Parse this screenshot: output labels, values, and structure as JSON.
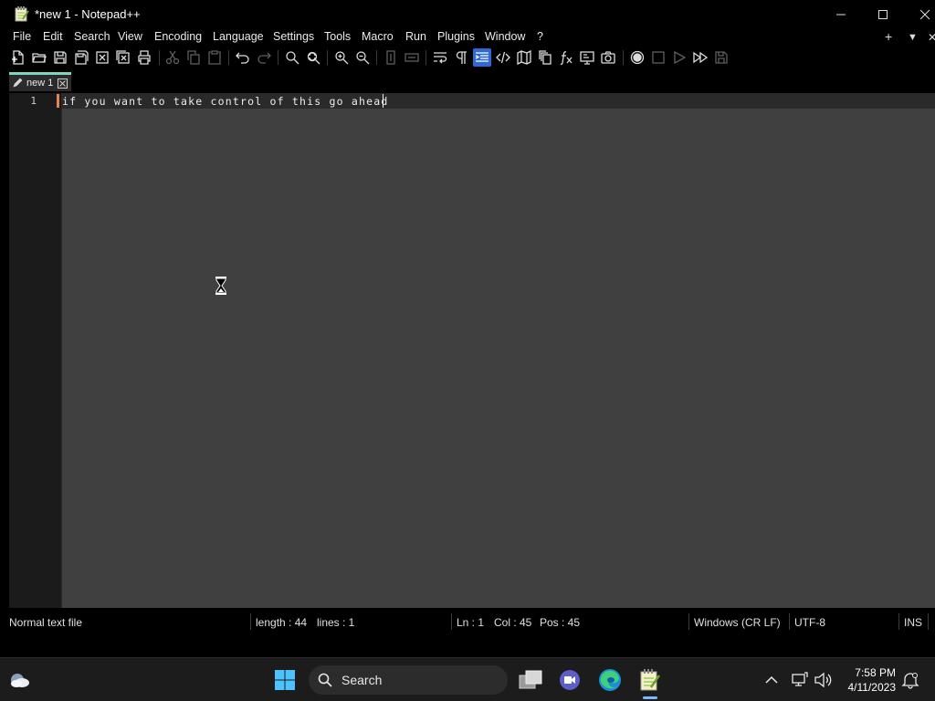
{
  "window": {
    "title": "*new 1 - Notepad++",
    "controls": [
      "minimize",
      "maximize",
      "close"
    ]
  },
  "menu": {
    "items": [
      "File",
      "Edit",
      "Search",
      "View",
      "Encoding",
      "Language",
      "Settings",
      "Tools",
      "Macro",
      "Run",
      "Plugins",
      "Window",
      "?"
    ],
    "right_actions": [
      "+",
      "▼",
      "✕"
    ]
  },
  "toolbar": {
    "icons": [
      "new-file-icon",
      "open-file-icon",
      "save-icon",
      "save-all-icon",
      "close-icon",
      "close-all-icon",
      "print-icon",
      "cut-icon",
      "copy-icon",
      "paste-icon",
      "undo-icon",
      "redo-icon",
      "find-icon",
      "replace-icon",
      "zoom-in-icon",
      "zoom-out-icon",
      "sync-vertical-icon",
      "sync-horizontal-icon",
      "word-wrap-icon",
      "show-all-characters-icon",
      "indent-guide-icon",
      "xml-tag-icon",
      "document-map-icon",
      "document-list-icon",
      "function-list-icon",
      "folder-workspace-icon",
      "monitoring-icon",
      "record-macro-icon",
      "stop-recording-icon",
      "playback-macro-icon",
      "run-macro-multiple-icon",
      "save-macro-icon"
    ]
  },
  "tab": {
    "label": "new 1"
  },
  "editor": {
    "line_number": "1",
    "text": "if you want to take control of this go ahead"
  },
  "status": {
    "file_type": "Normal text file",
    "length": "length : 44",
    "lines": "lines : 1",
    "ln": "Ln : 1",
    "col": "Col : 45",
    "pos": "Pos : 45",
    "eol": "Windows (CR LF)",
    "encoding": "UTF-8",
    "mode": "INS"
  },
  "taskbar": {
    "search_label": "Search",
    "time": "7:58 PM",
    "date": "4/11/2023"
  },
  "colors": {
    "tab_accent": "#7bd7c2",
    "editor_background": "#404040",
    "caret_margin": "#e8834c",
    "toolbar_active": "#2f6ad3"
  }
}
